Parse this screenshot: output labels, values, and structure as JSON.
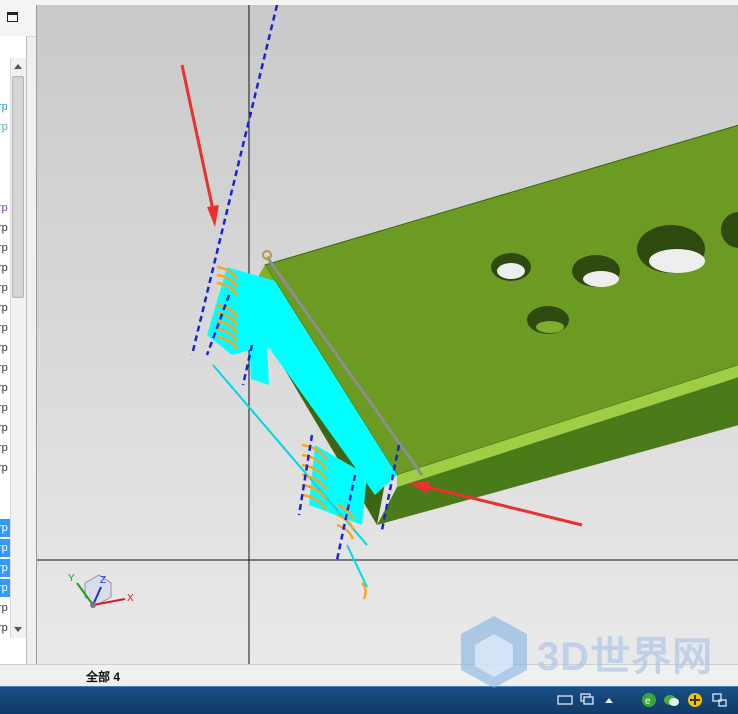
{
  "status_bar": {
    "selection_text": "全部 4"
  },
  "tree_panel": {
    "rows": [
      {
        "text": "rp",
        "state": "teal"
      },
      {
        "text": "rp",
        "state": "teal2"
      },
      {
        "text": "rp",
        "state": "purple"
      },
      {
        "text": "rp",
        "state": "normal"
      },
      {
        "text": "rp",
        "state": "normal"
      },
      {
        "text": "rp",
        "state": "normal"
      },
      {
        "text": "rp",
        "state": "normal"
      },
      {
        "text": "rp",
        "state": "normal"
      },
      {
        "text": "rp",
        "state": "normal"
      },
      {
        "text": "rp",
        "state": "normal"
      },
      {
        "text": "rp",
        "state": "normal"
      },
      {
        "text": "rp",
        "state": "normal"
      },
      {
        "text": "rp",
        "state": "normal"
      },
      {
        "text": "rp",
        "state": "normal"
      },
      {
        "text": "rp",
        "state": "normal"
      },
      {
        "text": "rp",
        "state": "normal"
      },
      {
        "text": "rp",
        "state": "selected"
      },
      {
        "text": "rp",
        "state": "selected"
      },
      {
        "text": "rp",
        "state": "selected"
      },
      {
        "text": "rp",
        "state": "selected"
      },
      {
        "text": "rp",
        "state": "normal"
      },
      {
        "text": "rp",
        "state": "normal"
      }
    ]
  },
  "axis_triad": {
    "x_label": "X",
    "y_label": "Y",
    "z_label": "Z"
  },
  "watermark": {
    "text": "3D世界网"
  },
  "colors": {
    "plate_green": "#6b9b22",
    "selection_cyan": "#00ffff",
    "curve_orange": "#f5a623",
    "dashed_blue": "#1a22d6",
    "arrow_red": "#e8322e"
  }
}
